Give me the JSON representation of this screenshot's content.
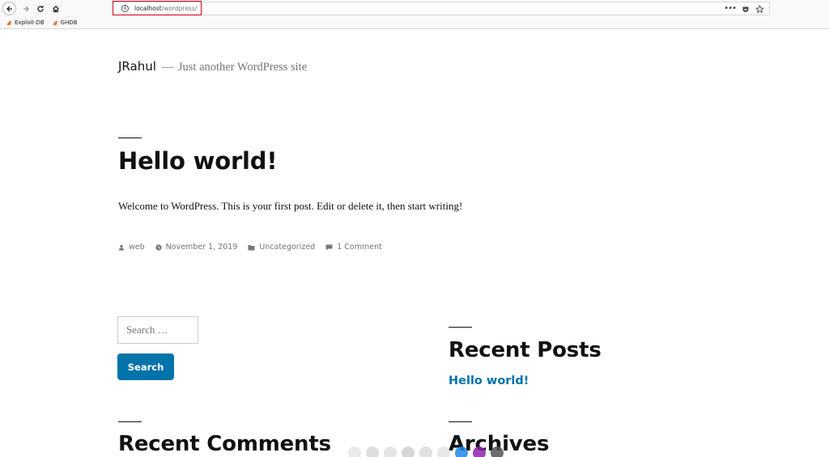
{
  "browser": {
    "url_host": "localhost",
    "url_path": "/wordpress/",
    "bookmarks": [
      {
        "label": "Exploit-DB",
        "icon": "exploitdb-icon"
      },
      {
        "label": "GHDB",
        "icon": "ghdb-icon"
      }
    ],
    "url_actions_more": "•••"
  },
  "site": {
    "title": "JRahul",
    "separator": "—",
    "description": "Just another WordPress site"
  },
  "post": {
    "title": "Hello world!",
    "content": "Welcome to WordPress. This is your first post. Edit or delete it, then start writing!",
    "meta": {
      "author": "web",
      "date": "November 1, 2019",
      "category": "Uncategorized",
      "comments": "1 Comment"
    }
  },
  "sidebar": {
    "search_placeholder": "Search …",
    "search_button": "Search",
    "recent_posts_title": "Recent Posts",
    "recent_posts": [
      "Hello world!"
    ],
    "recent_comments_title": "Recent Comments",
    "archives_title": "Archives"
  },
  "colors": {
    "link": "#0073aa",
    "highlight_border": "#d0021b",
    "muted_text": "#767676"
  }
}
